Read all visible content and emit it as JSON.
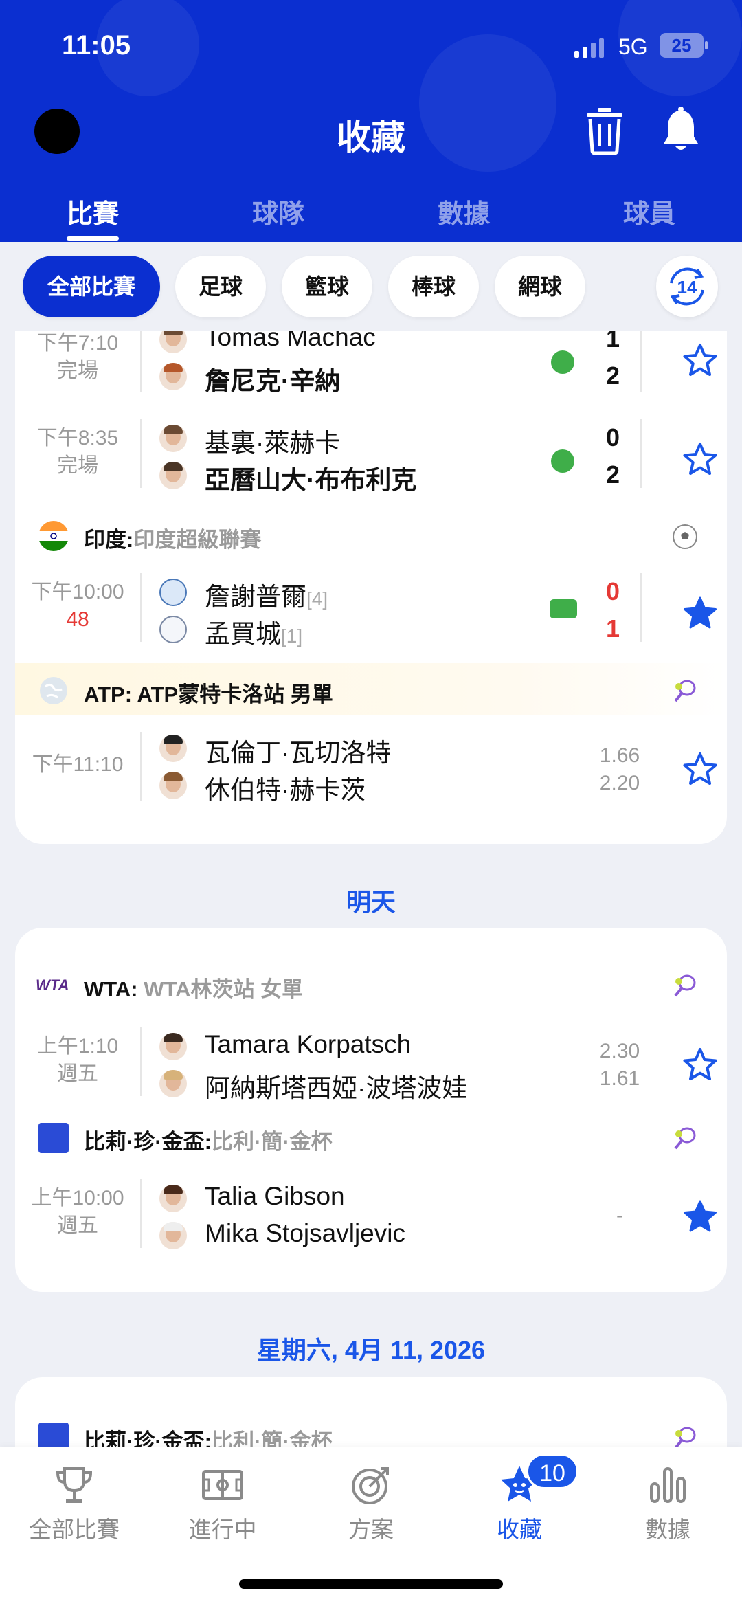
{
  "status_bar": {
    "time": "11:05",
    "network": "5G",
    "battery": "25"
  },
  "header": {
    "title": "收藏"
  },
  "tabs": [
    {
      "label": "比賽",
      "active": true
    },
    {
      "label": "球隊",
      "active": false
    },
    {
      "label": "數據",
      "active": false
    },
    {
      "label": "球員",
      "active": false
    }
  ],
  "filters": [
    {
      "label": "全部比賽",
      "active": true
    },
    {
      "label": "足球",
      "active": false
    },
    {
      "label": "籃球",
      "active": false
    },
    {
      "label": "棒球",
      "active": false
    },
    {
      "label": "網球",
      "active": false
    }
  ],
  "refresh_badge": "14",
  "today": {
    "matches_top": [
      {
        "time": "下午7:10",
        "status": "完場",
        "home": "Tomas Machac",
        "away": "詹尼克·辛納",
        "home_score": "1",
        "away_score": "2",
        "starred": false
      },
      {
        "time": "下午8:35",
        "status": "完場",
        "home": "基裏·萊赫卡",
        "away": "亞曆山大·布布利克",
        "home_score": "0",
        "away_score": "2",
        "starred": false
      }
    ],
    "league_india": {
      "prefix": "印度:",
      "name": "印度超級聯賽"
    },
    "match_india": {
      "time": "下午10:00",
      "minute": "48",
      "home": "詹謝普爾",
      "home_seed": "[4]",
      "away": "孟買城",
      "away_seed": "[1]",
      "home_score": "0",
      "away_score": "1",
      "starred": true
    },
    "league_atp": {
      "prefix": "ATP:",
      "name": "ATP蒙特卡洛站 男單"
    },
    "match_atp": {
      "time": "下午11:10",
      "home": "瓦倫丁·瓦切洛特",
      "away": "休伯特·赫卡茨",
      "home_odds": "1.66",
      "away_odds": "2.20",
      "starred": false
    }
  },
  "tomorrow": {
    "label": "明天",
    "league_wta": {
      "logo": "WTA",
      "prefix": "WTA:",
      "name": "WTA林茨站 女單"
    },
    "match_wta": {
      "time": "上午1:10",
      "day": "週五",
      "home": "Tamara Korpatsch",
      "away": "阿納斯塔西婭·波塔波娃",
      "home_odds": "2.30",
      "away_odds": "1.61",
      "starred": false
    },
    "league_bjk": {
      "prefix": "比莉·珍·金盃:",
      "name": "比利·簡·金杯"
    },
    "match_bjk": {
      "time": "上午10:00",
      "day": "週五",
      "home": "Talia Gibson",
      "away": "Mika Stojsavljevic",
      "odds": "-",
      "starred": true
    }
  },
  "saturday": {
    "label": "星期六, 4月 11, 2026",
    "league_bjk": {
      "prefix": "比莉·珍·金盃:",
      "name": "比利·簡·金杯"
    }
  },
  "bottom_nav": [
    {
      "label": "全部比賽",
      "icon": "trophy-icon",
      "active": false
    },
    {
      "label": "進行中",
      "icon": "field-icon",
      "active": false
    },
    {
      "label": "方案",
      "icon": "target-icon",
      "active": false
    },
    {
      "label": "收藏",
      "icon": "star-icon",
      "active": true,
      "badge": "10"
    },
    {
      "label": "數據",
      "icon": "bar-chart-icon",
      "active": false
    }
  ],
  "colors": {
    "header_blue": "#0b2fd0",
    "accent_blue": "#1a56e8",
    "live_red": "#e53935",
    "live_green": "#3fae49"
  }
}
